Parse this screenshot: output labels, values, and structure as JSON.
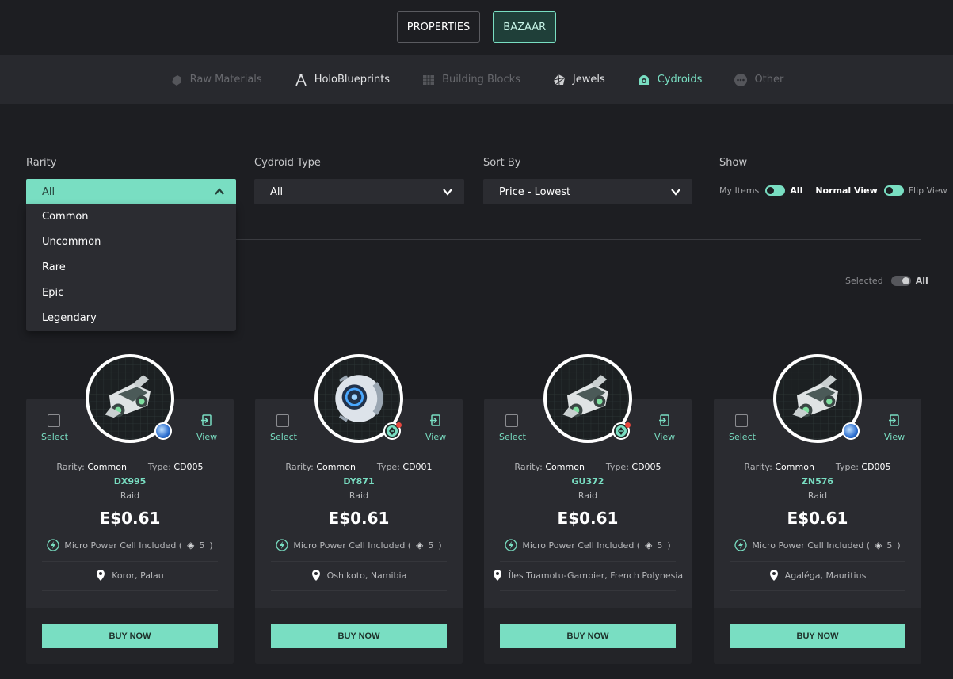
{
  "top_tabs": [
    {
      "label": "PROPERTIES"
    },
    {
      "label": "BAZAAR"
    }
  ],
  "categories": [
    {
      "label": "Raw Materials",
      "icon": "raw-materials-icon"
    },
    {
      "label": "HoloBlueprints",
      "icon": "compass-icon"
    },
    {
      "label": "Building Blocks",
      "icon": "building-blocks-icon"
    },
    {
      "label": "Jewels",
      "icon": "jewel-icon"
    },
    {
      "label": "Cydroids",
      "icon": "cydroid-icon"
    },
    {
      "label": "Other",
      "icon": "more-icon"
    }
  ],
  "filters": {
    "rarity_label": "Rarity",
    "rarity_value": "All",
    "rarity_options": [
      "Common",
      "Uncommon",
      "Rare",
      "Epic",
      "Legendary"
    ],
    "type_label": "Cydroid Type",
    "type_value": "All",
    "sort_label": "Sort By",
    "sort_value": "Price - Lowest",
    "show_label": "Show",
    "my_items": "My Items",
    "all": "All",
    "normal_view": "Normal View",
    "flip_view": "Flip View"
  },
  "selection": {
    "selected_label": "Selected",
    "all_label": "All"
  },
  "card_labels": {
    "select": "Select",
    "view": "View",
    "rarity": "Rarity:",
    "type": "Type:",
    "buy": "BUY NOW",
    "power_prefix": "Micro Power Cell Included (",
    "power_suffix": ")"
  },
  "cards": [
    {
      "rarity": "Common",
      "type": "CD005",
      "code": "DX995",
      "kind": "Raid",
      "price": "E$0.61",
      "power": "5",
      "location": "Koror, Palau",
      "badge": "globe-icon"
    },
    {
      "rarity": "Common",
      "type": "CD001",
      "code": "DY871",
      "kind": "Raid",
      "price": "E$0.61",
      "power": "5",
      "location": "Oshikoto, Namibia",
      "badge": "ecoin-icon"
    },
    {
      "rarity": "Common",
      "type": "CD005",
      "code": "GU372",
      "kind": "Raid",
      "price": "E$0.61",
      "power": "5",
      "location": "Îles Tuamotu-Gambier, French Polynesia",
      "badge": "ecoin-icon"
    },
    {
      "rarity": "Common",
      "type": "CD005",
      "code": "ZN576",
      "kind": "Raid",
      "price": "E$0.61",
      "power": "5",
      "location": "Agaléga, Mauritius",
      "badge": "globe-icon"
    }
  ],
  "colors": {
    "accent": "#79dec2",
    "background": "#1d1e22",
    "card": "#2a2b30",
    "notification": "#e8473f"
  }
}
